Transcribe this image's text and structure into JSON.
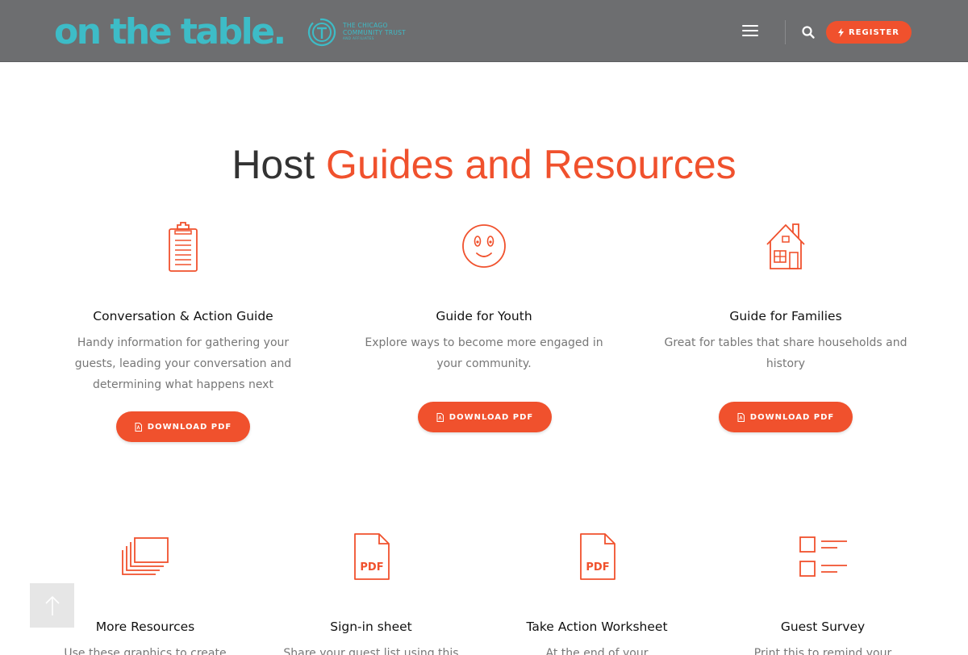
{
  "header": {
    "logo_text": "on the table",
    "logo_dot": ".",
    "trust_line1": "THE CHICAGO",
    "trust_line2": "COMMUNITY TRUST",
    "trust_line3": "AND AFFILIATES",
    "register_label": "REGISTER",
    "icons": {
      "menu": "hamburger-icon",
      "search": "search-icon",
      "register": "bolt-icon"
    }
  },
  "heading": {
    "plain": "Host",
    "accent": "Guides and Resources"
  },
  "guides": [
    {
      "title": "Conversation & Action Guide",
      "desc_lines": [
        "Handy information for gathering your",
        "guests, leading your conversation and",
        "determining what happens next"
      ],
      "button": "DOWNLOAD PDF",
      "icon": "clipboard-icon"
    },
    {
      "title": "Guide for Youth",
      "desc_lines": [
        "Explore ways to become more engaged in",
        "your community."
      ],
      "button": "DOWNLOAD PDF",
      "icon": "smiley-icon"
    },
    {
      "title": "Guide for Families",
      "desc_lines": [
        "Great for tables that share households and",
        "history"
      ],
      "button": "DOWNLOAD PDF",
      "icon": "house-icon"
    }
  ],
  "resources": [
    {
      "title": "More Resources",
      "desc": "Use these graphics to create",
      "icon": "stacked-images-icon"
    },
    {
      "title": "Sign-in sheet",
      "desc": "Share your guest list using this",
      "icon": "pdf-file-icon",
      "icon_label": "PDF"
    },
    {
      "title": "Take Action Worksheet",
      "desc": "At the end of your",
      "icon": "pdf-file-icon",
      "icon_label": "PDF"
    },
    {
      "title": "Guest Survey",
      "desc": "Print this to remind your",
      "icon": "checklist-icon"
    }
  ],
  "colors": {
    "accent": "#f0512d",
    "brand": "#3dbcc7",
    "header_bg": "#6d6e70"
  }
}
